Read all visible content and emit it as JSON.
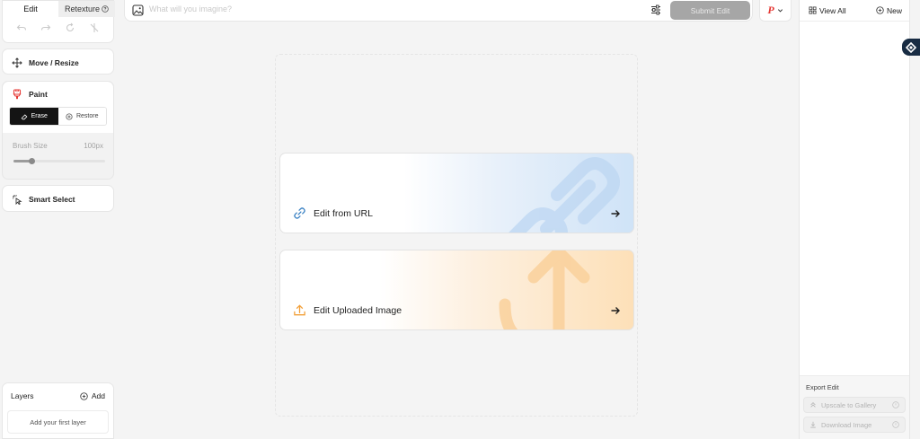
{
  "tabs": {
    "edit": "Edit",
    "retexture": "Retexture"
  },
  "tools": {
    "move": "Move / Resize",
    "paint": "Paint",
    "erase": "Erase",
    "restore": "Restore",
    "brush_label": "Brush Size",
    "brush_value": "100px",
    "brush_level": 0.2,
    "smart": "Smart Select"
  },
  "layers": {
    "title": "Layers",
    "add": "Add",
    "empty": "Add your first layer"
  },
  "prompt": {
    "placeholder": "What will you imagine?",
    "submit": "Submit Edit"
  },
  "account": {
    "initial": "P"
  },
  "right": {
    "view_all": "View All",
    "new": "New",
    "export_label": "Export Edit",
    "upscale": "Upscale to Gallery",
    "download": "Download Image"
  },
  "canvas": {
    "url_label": "Edit from URL",
    "upload_label": "Edit Uploaded Image"
  },
  "colors": {
    "accent_red": "#e53935",
    "link_blue": "#3b82c4",
    "upload_orange": "#f2a03a",
    "dark": "#141414"
  },
  "icons": {
    "undo": "undo-icon",
    "redo": "redo-icon",
    "rotate": "rotate-icon",
    "flip": "flip-icon",
    "move": "move-arrows-icon",
    "paint": "paint-brush-icon",
    "eraser": "eraser-icon",
    "restore": "restore-icon",
    "smart": "smart-select-cursor-icon",
    "add": "plus-circle-icon",
    "image": "image-icon",
    "settings": "sliders-icon",
    "grid": "grid-icon",
    "link": "link-icon",
    "upload": "upload-icon",
    "arrow": "arrow-right-icon"
  }
}
